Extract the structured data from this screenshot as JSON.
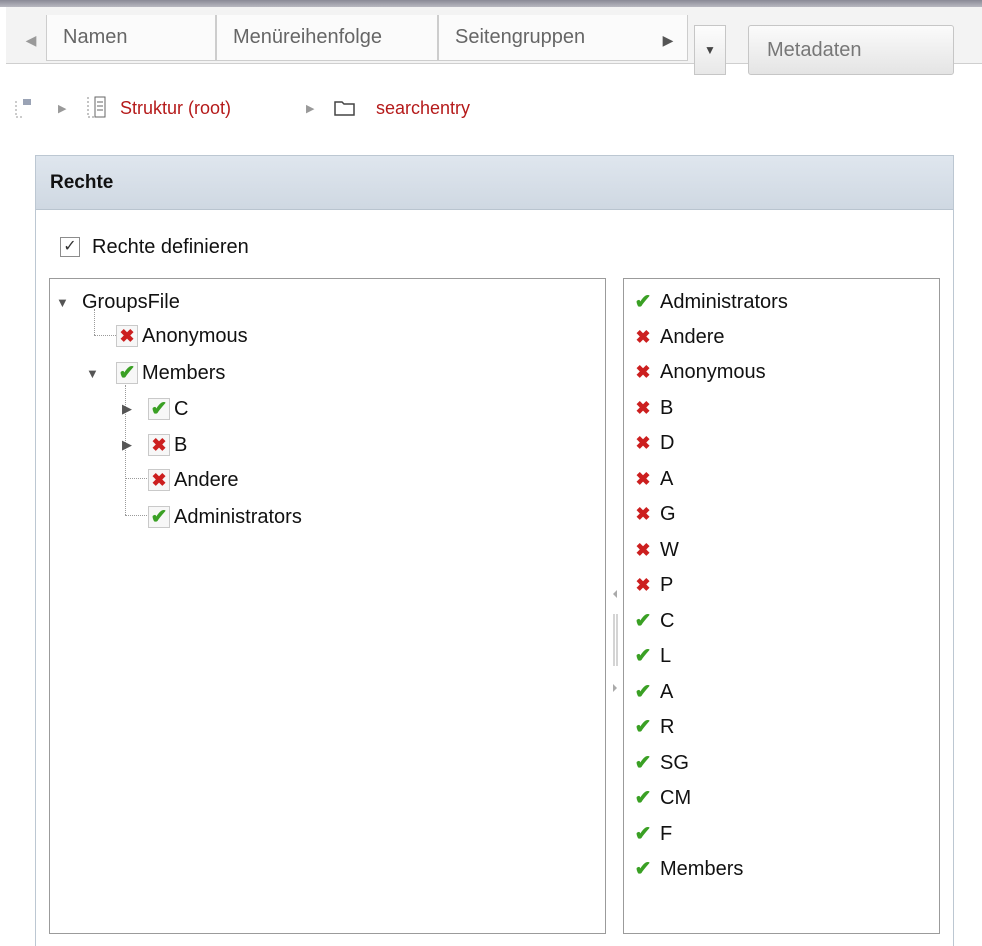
{
  "tabs": [
    "Namen",
    "Menüreihenfolge",
    "Seitengruppen"
  ],
  "metadata_button": "Metadaten",
  "breadcrumb": {
    "root": "Struktur (root)",
    "current": "searchentry"
  },
  "panel": {
    "title": "Rechte",
    "define_label": "Rechte definieren",
    "define_checked": true
  },
  "tree": {
    "root": "GroupsFile",
    "nodes": [
      {
        "label": "Anonymous",
        "allowed": false
      },
      {
        "label": "Members",
        "allowed": true
      },
      {
        "label": "C",
        "allowed": true
      },
      {
        "label": "B",
        "allowed": false
      },
      {
        "label": "Andere",
        "allowed": false
      },
      {
        "label": "Administrators",
        "allowed": true
      }
    ]
  },
  "rights_list": [
    {
      "label": "Administrators",
      "allowed": true
    },
    {
      "label": "Andere",
      "allowed": false
    },
    {
      "label": "Anonymous",
      "allowed": false
    },
    {
      "label": "B",
      "allowed": false
    },
    {
      "label": "D",
      "allowed": false
    },
    {
      "label": "A",
      "allowed": false
    },
    {
      "label": "G",
      "allowed": false
    },
    {
      "label": "W",
      "allowed": false
    },
    {
      "label": "P",
      "allowed": false
    },
    {
      "label": "C",
      "allowed": true
    },
    {
      "label": "L",
      "allowed": true
    },
    {
      "label": "A",
      "allowed": true
    },
    {
      "label": "R",
      "allowed": true
    },
    {
      "label": "SG",
      "allowed": true
    },
    {
      "label": "CM",
      "allowed": true
    },
    {
      "label": "F",
      "allowed": true
    },
    {
      "label": "Members",
      "allowed": true
    }
  ],
  "colors": {
    "link": "#b51a1a",
    "allowed": "#3aa024",
    "denied": "#cc1f1f",
    "panel_header": "#d6dee7"
  }
}
